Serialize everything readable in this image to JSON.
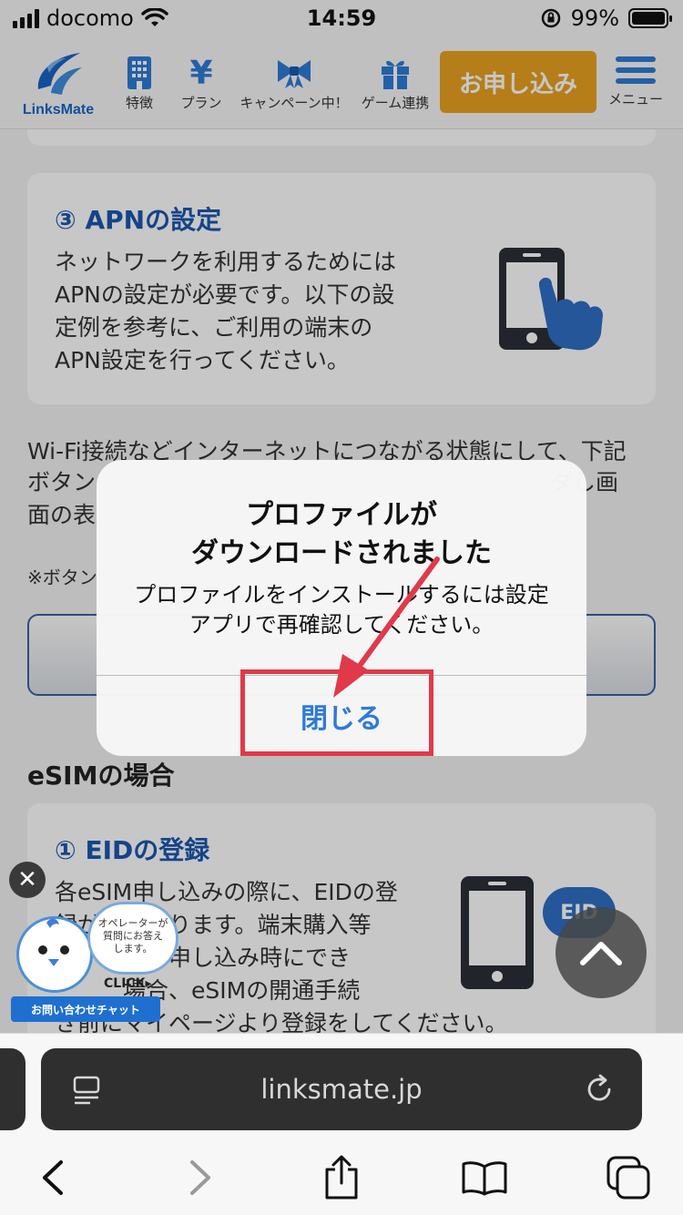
{
  "status_bar": {
    "carrier": "docomo",
    "time": "14:59",
    "battery": "99%",
    "battery_level": 0.99
  },
  "header": {
    "logo_text": "LinksMate",
    "nav": [
      {
        "label": "特徴",
        "icon": "building-icon"
      },
      {
        "label": "プラン",
        "icon": "yen-icon"
      },
      {
        "label": "キャンペーン中！",
        "icon": "ribbon-icon"
      },
      {
        "label": "ゲーム連携",
        "icon": "gift-icon"
      }
    ],
    "apply_label": "お申し込み",
    "menu_label": "メニュー"
  },
  "content": {
    "apn_card": {
      "title": "③ APNの設定",
      "lines": [
        "ネットワークを利用するためには",
        "APNの設定が必要です。以下の設",
        "定例を参考に、ご利用の端末の",
        "APN設定を行ってください。"
      ]
    },
    "wifi_para": {
      "line1": "Wi-Fi接続などインターネットにつながる状態にして、下記",
      "line2_left": "ボタン",
      "line2_right": "ダし画",
      "line3_left": "面の表"
    },
    "note_fragment": "※ボタン",
    "esim_title": "eSIMの場合",
    "eid_card": {
      "title": "① EIDの登録",
      "lines": [
        "各eSIM申し込みの際に、EIDの登",
        "録が　　なります。端末購入等",
        "　　　力が申し込み時にでき",
        "　　　場合、eSIMの開通手続",
        "き前にマイページより登録をしてください。"
      ],
      "badge": "EID"
    },
    "chat": {
      "bubble": [
        "オペレーターが",
        "質問にお答え",
        "します。"
      ],
      "click": "CLICK▸",
      "label": "お問い合わせチャット"
    }
  },
  "dialog": {
    "title_line1": "プロファイルが",
    "title_line2": "ダウンロードされました",
    "message_line1": "プロファイルをインストールするには設定",
    "message_line2": "アプリで再確認してください。",
    "close_label": "閉じる",
    "highlight_color": "#e03a4a"
  },
  "browser": {
    "url": "linksmate.jp"
  },
  "colors": {
    "brand_blue": "#2d7bd6",
    "apply_orange": "#e8a220",
    "ios_link_blue": "#2f7ad9"
  }
}
